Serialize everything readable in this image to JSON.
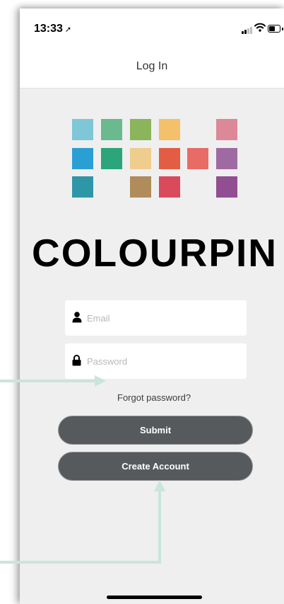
{
  "status_bar": {
    "time": "13:33"
  },
  "nav": {
    "title": "Log In"
  },
  "logo": {
    "brand_name": "COLOURPIN",
    "tile_colors": [
      "#7fc6d6",
      "#6ab98f",
      "#8ab55a",
      "#f4c06a",
      "#dc8898",
      "#2a9fd4",
      "#2ca57a",
      "#efcd8f",
      "#e25d44",
      "#e86b66",
      "#9f6aa2",
      "#2e97a7",
      "#b08c5c",
      "#d84a5c",
      "#914e93"
    ]
  },
  "form": {
    "email_placeholder": "Email",
    "password_placeholder": "Password",
    "forgot_label": "Forgot password?",
    "submit_label": "Submit",
    "create_label": "Create Account"
  },
  "colors": {
    "button_bg": "#565a5c",
    "page_bg": "#efefef",
    "annotation_arrow": "#c9e5dc"
  }
}
